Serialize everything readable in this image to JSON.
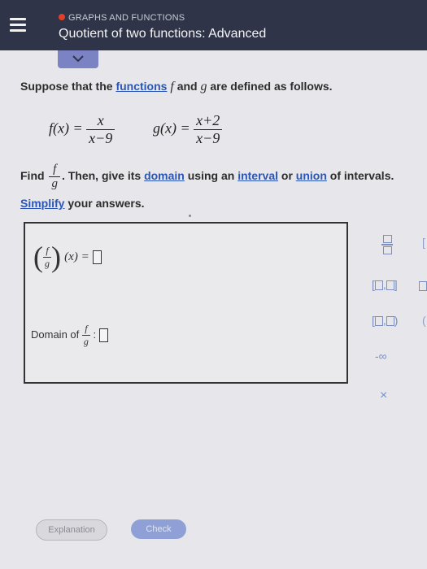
{
  "header": {
    "section": "GRAPHS AND FUNCTIONS",
    "title": "Quotient of two functions: Advanced"
  },
  "problem": {
    "intro_prefix": "Suppose that the",
    "intro_link": "functions",
    "intro_f": "f",
    "intro_and": "and",
    "intro_g": "g",
    "intro_suffix": "are defined as follows.",
    "f_lhs": "f(x) =",
    "f_num": "x",
    "f_den": "x−9",
    "g_lhs": "g(x) =",
    "g_num": "x+2",
    "g_den": "x−9"
  },
  "instruction": {
    "find": "Find",
    "frac_num": "f",
    "frac_den": "g",
    "then": ". Then, give its",
    "domain_link": "domain",
    "using": "using an",
    "interval_link": "interval",
    "or": "or",
    "union_link": "union",
    "of_intervals": "of intervals.",
    "simplify_link": "Simplify",
    "simplify_rest": "your answers."
  },
  "answer": {
    "paren_open": "(",
    "paren_close": ")",
    "frac_num": "f",
    "frac_den": "g",
    "arg": "(x) =",
    "domain_label": "Domain of",
    "colon": ":"
  },
  "palette": {
    "closed_interval": "[",
    "closed_interval_end": "]",
    "open_interval": "(",
    "open_interval_end": ")",
    "neg_infinity": "-∞",
    "clear": "×",
    "edge_bracket": "[",
    "edge_paren": "("
  },
  "footer": {
    "explanation": "Explanation",
    "check": "Check"
  }
}
